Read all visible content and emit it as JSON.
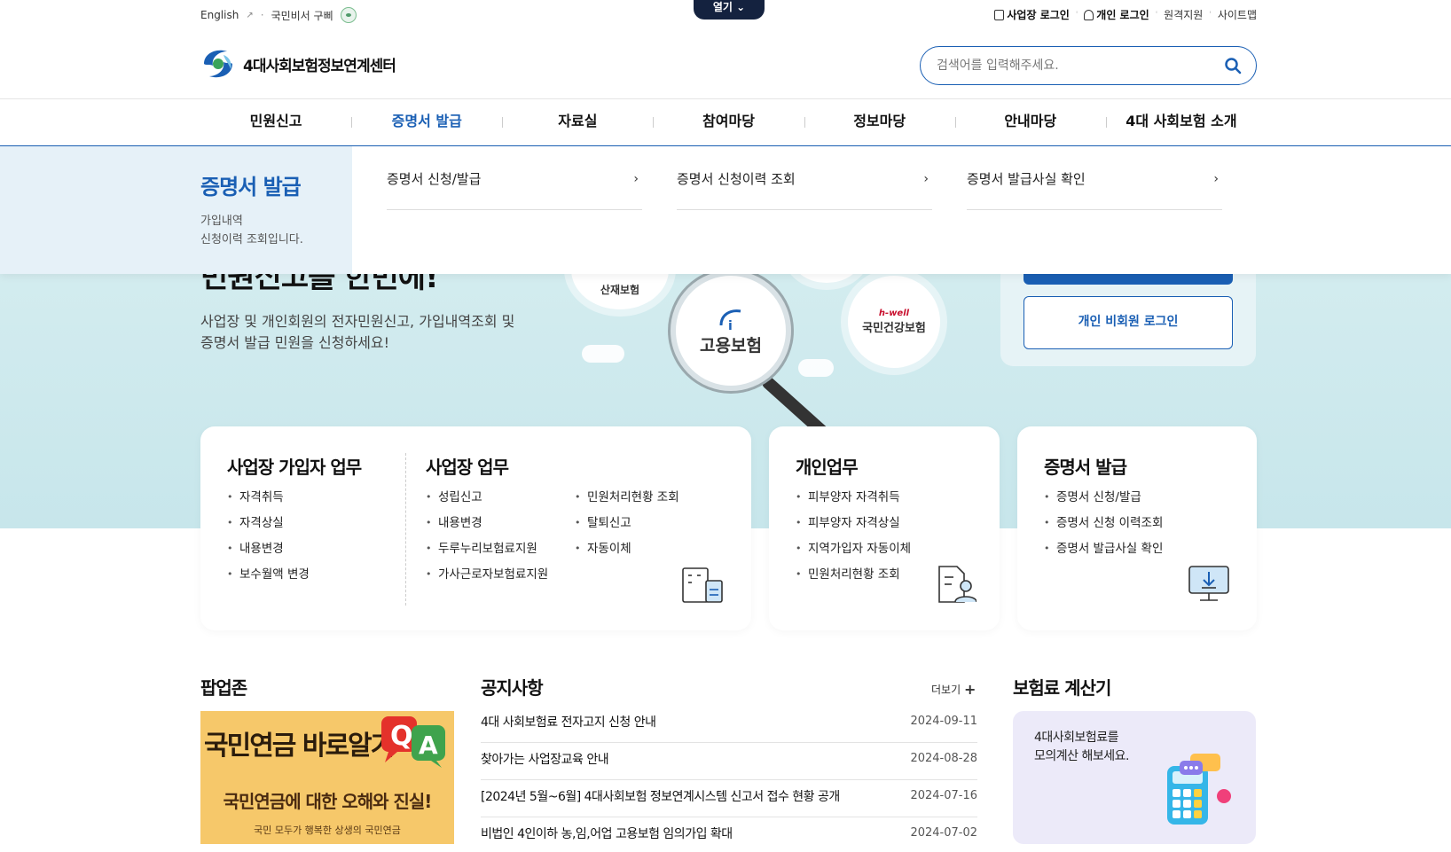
{
  "util": {
    "english": "English",
    "assistant": "국민비서 구삐",
    "open_tab": "열기",
    "biz_login": "사업장 로그인",
    "personal_login": "개인 로그인",
    "remote_support": "원격지원",
    "sitemap": "사이트맵"
  },
  "header": {
    "logo_text": "4대사회보험정보연계센터",
    "search_placeholder": "검색어를 입력해주세요."
  },
  "gnb": {
    "items": [
      "민원신고",
      "증명서 발급",
      "자료실",
      "참여마당",
      "정보마당",
      "안내마당",
      "4대 사회보험 소개"
    ],
    "active_index": 1
  },
  "dropdown": {
    "title": "증명서 발급",
    "desc_line1": "가입내역",
    "desc_line2": "신청이력 조회입니다.",
    "links": [
      "증명서 신청/발급",
      "증명서 신청이력 조회",
      "증명서 발급사실 확인"
    ]
  },
  "hero": {
    "headline_partial": "민원신고를 한번에!",
    "desc_line1": "사업장 및 개인회원의 전자민원신고, 가입내역조회 및",
    "desc_line2": "증명서 발급 민원을 신청하세요!",
    "circle_left": "산재보험",
    "magnifier_label": "고용보험",
    "circle_right_brand": "h-well",
    "circle_right": "국민건강보험",
    "personal_login_btn": "개인 비회원 로그인"
  },
  "cards": {
    "biz_member": {
      "title": "사업장 가입자 업무",
      "items": [
        "자격취득",
        "자격상실",
        "내용변경",
        "보수월액 변경"
      ]
    },
    "biz": {
      "title": "사업장 업무",
      "col1": [
        "성립신고",
        "내용변경",
        "두루누리보험료지원",
        "가사근로자보험료지원"
      ],
      "col2": [
        "민원처리현황 조회",
        "탈퇴신고",
        "자동이체"
      ]
    },
    "personal": {
      "title": "개인업무",
      "items": [
        "피부양자 자격취득",
        "피부양자 자격상실",
        "지역가입자 자동이체",
        "민원처리현황 조회"
      ]
    },
    "cert": {
      "title": "증명서 발급",
      "items": [
        "증명서 신청/발급",
        "증명서 신청 이력조회",
        "증명서 발급사실 확인"
      ]
    }
  },
  "popup": {
    "title": "팝업존",
    "banner_title": "국민연금 바로알기",
    "banner_sub": "국민연금에 대한 오해와 진실!",
    "banner_foot": "국민 모두가 행복한 상생의 국민연금"
  },
  "notice": {
    "title": "공지사항",
    "more": "더보기",
    "items": [
      {
        "title": "4대 사회보험료 전자고지 신청 안내",
        "date": "2024-09-11"
      },
      {
        "title": "찾아가는 사업장교육 안내",
        "date": "2024-08-28"
      },
      {
        "title": "[2024년 5월~6월] 4대사회보험 정보연계시스템 신고서 접수 현황 공개",
        "date": "2024-07-16"
      },
      {
        "title": "비법인 4인이하 농,임,어업 고용보험 임의가입 확대",
        "date": "2024-07-02"
      }
    ]
  },
  "calculator": {
    "title": "보험료 계산기",
    "line1": "4대사회보험료를",
    "line2": "모의계산 해보세요."
  },
  "colors": {
    "primary": "#1a5fb4",
    "navy": "#14223f",
    "hero_bg": "#cde9ee",
    "dropdown_side": "#e6f1f8",
    "calc_bg": "#eceaf9",
    "banner_bg": "#f6c86a"
  }
}
